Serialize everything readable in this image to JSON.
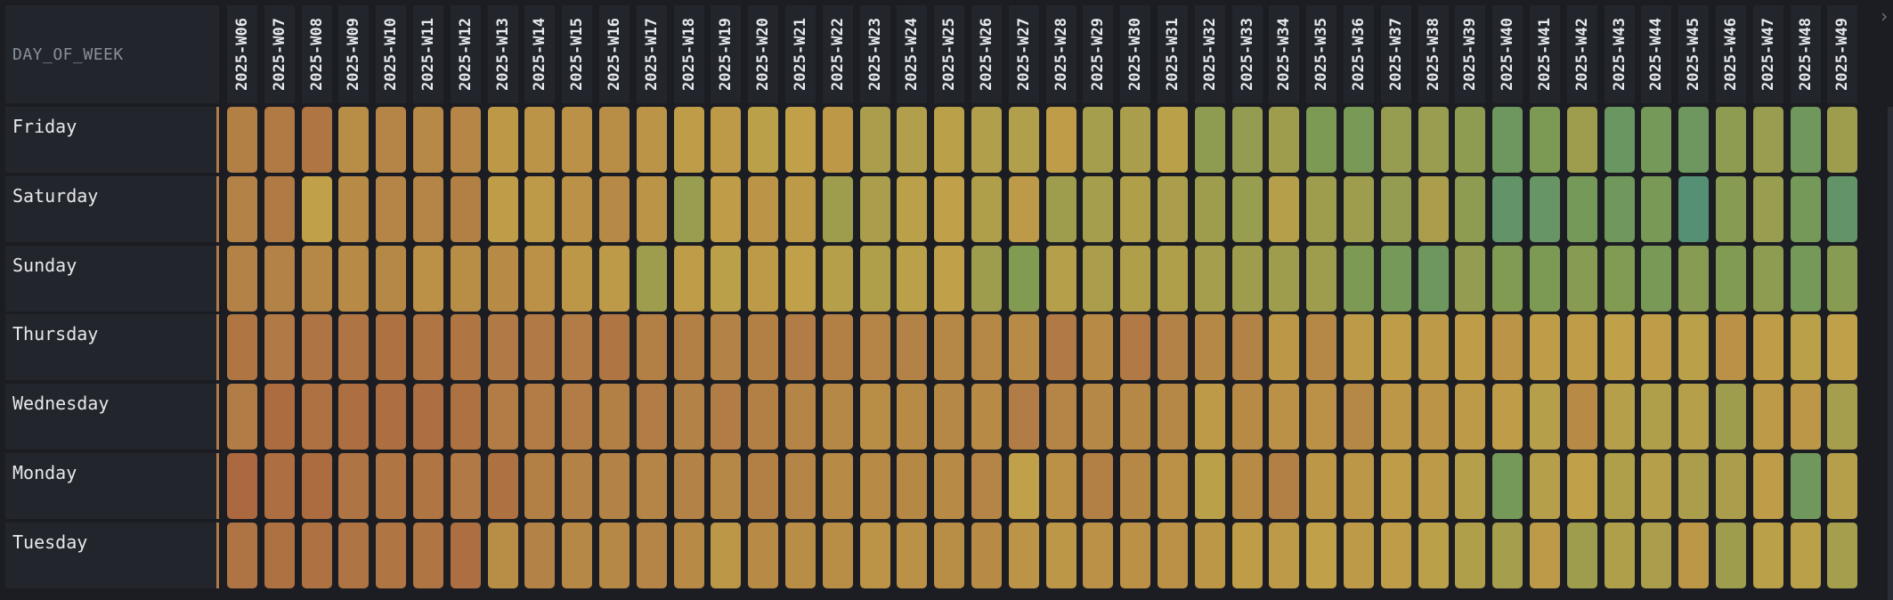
{
  "row_header_title": "DAY_OF_WEEK",
  "scroll_arrow": "›",
  "chart_data": {
    "type": "heatmap",
    "x": [
      "2025-W06",
      "2025-W07",
      "2025-W08",
      "2025-W09",
      "2025-W10",
      "2025-W11",
      "2025-W12",
      "2025-W13",
      "2025-W14",
      "2025-W15",
      "2025-W16",
      "2025-W17",
      "2025-W18",
      "2025-W19",
      "2025-W20",
      "2025-W21",
      "2025-W22",
      "2025-W23",
      "2025-W24",
      "2025-W25",
      "2025-W26",
      "2025-W27",
      "2025-W28",
      "2025-W29",
      "2025-W30",
      "2025-W31",
      "2025-W32",
      "2025-W33",
      "2025-W34",
      "2025-W35",
      "2025-W36",
      "2025-W37",
      "2025-W38",
      "2025-W39",
      "2025-W40",
      "2025-W41",
      "2025-W42",
      "2025-W43",
      "2025-W44",
      "2025-W45",
      "2025-W46",
      "2025-W47",
      "2025-W48",
      "2025-W49"
    ],
    "y": [
      "Friday",
      "Saturday",
      "Sunday",
      "Thursday",
      "Wednesday",
      "Monday",
      "Tuesday"
    ],
    "color_scale": [
      "#a85a3a",
      "#b07a45",
      "#c0a048",
      "#7a9a55",
      "#4e8e7a"
    ],
    "values": [
      [
        0.28,
        0.25,
        0.22,
        0.38,
        0.32,
        0.35,
        0.33,
        0.45,
        0.42,
        0.4,
        0.38,
        0.42,
        0.48,
        0.46,
        0.52,
        0.5,
        0.45,
        0.58,
        0.55,
        0.52,
        0.55,
        0.55,
        0.48,
        0.6,
        0.58,
        0.52,
        0.68,
        0.66,
        0.62,
        0.74,
        0.76,
        0.65,
        0.64,
        0.68,
        0.82,
        0.74,
        0.62,
        0.84,
        0.78,
        0.82,
        0.68,
        0.64,
        0.8,
        0.62
      ],
      [
        0.3,
        0.25,
        0.5,
        0.36,
        0.32,
        0.32,
        0.28,
        0.48,
        0.46,
        0.4,
        0.35,
        0.42,
        0.64,
        0.48,
        0.42,
        0.46,
        0.62,
        0.58,
        0.52,
        0.5,
        0.56,
        0.46,
        0.62,
        0.6,
        0.56,
        0.58,
        0.62,
        0.64,
        0.54,
        0.62,
        0.62,
        0.66,
        0.58,
        0.68,
        0.88,
        0.86,
        0.78,
        0.8,
        0.76,
        0.96,
        0.7,
        0.64,
        0.78,
        0.88
      ],
      [
        0.3,
        0.3,
        0.34,
        0.36,
        0.34,
        0.4,
        0.38,
        0.36,
        0.4,
        0.44,
        0.46,
        0.62,
        0.48,
        0.52,
        0.46,
        0.5,
        0.54,
        0.56,
        0.52,
        0.5,
        0.62,
        0.72,
        0.54,
        0.58,
        0.56,
        0.56,
        0.6,
        0.62,
        0.62,
        0.62,
        0.74,
        0.78,
        0.82,
        0.66,
        0.72,
        0.74,
        0.7,
        0.72,
        0.76,
        0.7,
        0.72,
        0.68,
        0.78,
        0.7
      ],
      [
        0.22,
        0.24,
        0.2,
        0.2,
        0.18,
        0.22,
        0.22,
        0.24,
        0.24,
        0.26,
        0.22,
        0.28,
        0.28,
        0.3,
        0.28,
        0.26,
        0.28,
        0.32,
        0.3,
        0.34,
        0.34,
        0.36,
        0.24,
        0.36,
        0.24,
        0.3,
        0.34,
        0.3,
        0.44,
        0.34,
        0.46,
        0.48,
        0.46,
        0.48,
        0.42,
        0.48,
        0.48,
        0.5,
        0.48,
        0.52,
        0.4,
        0.48,
        0.52,
        0.5
      ],
      [
        0.26,
        0.14,
        0.18,
        0.16,
        0.16,
        0.16,
        0.18,
        0.26,
        0.26,
        0.26,
        0.28,
        0.26,
        0.3,
        0.26,
        0.28,
        0.32,
        0.34,
        0.38,
        0.36,
        0.34,
        0.36,
        0.26,
        0.32,
        0.34,
        0.34,
        0.34,
        0.46,
        0.36,
        0.4,
        0.4,
        0.34,
        0.44,
        0.42,
        0.46,
        0.48,
        0.54,
        0.36,
        0.54,
        0.56,
        0.54,
        0.62,
        0.46,
        0.44,
        0.6
      ],
      [
        0.12,
        0.16,
        0.14,
        0.2,
        0.22,
        0.22,
        0.24,
        0.18,
        0.28,
        0.3,
        0.3,
        0.32,
        0.3,
        0.34,
        0.28,
        0.32,
        0.36,
        0.36,
        0.34,
        0.36,
        0.32,
        0.5,
        0.4,
        0.28,
        0.34,
        0.4,
        0.52,
        0.36,
        0.28,
        0.44,
        0.44,
        0.48,
        0.46,
        0.54,
        0.78,
        0.54,
        0.5,
        0.56,
        0.54,
        0.58,
        0.58,
        0.48,
        0.8,
        0.54
      ],
      [
        0.2,
        0.18,
        0.18,
        0.2,
        0.22,
        0.22,
        0.16,
        0.38,
        0.3,
        0.34,
        0.34,
        0.32,
        0.36,
        0.44,
        0.36,
        0.38,
        0.38,
        0.42,
        0.4,
        0.38,
        0.36,
        0.42,
        0.44,
        0.4,
        0.4,
        0.4,
        0.44,
        0.48,
        0.46,
        0.5,
        0.46,
        0.48,
        0.52,
        0.56,
        0.6,
        0.46,
        0.62,
        0.56,
        0.58,
        0.44,
        0.62,
        0.52,
        0.52,
        0.6
      ]
    ]
  }
}
